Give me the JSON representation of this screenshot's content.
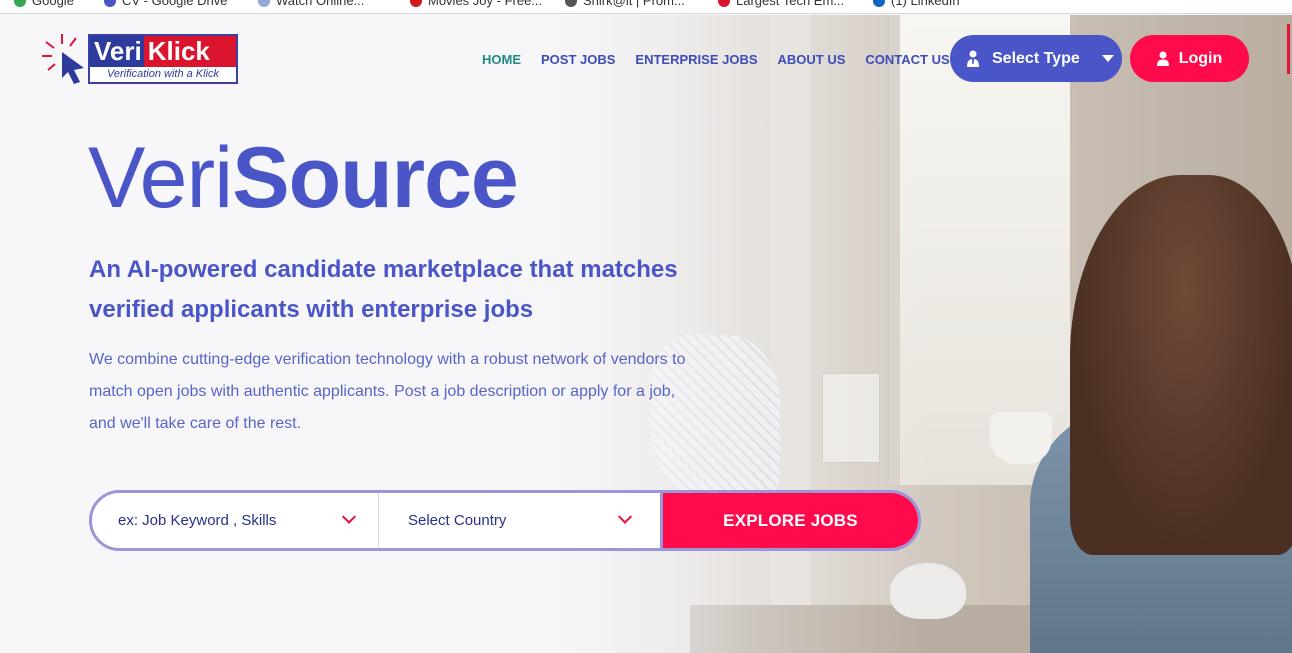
{
  "bookmarks": [
    {
      "label": "Google",
      "color": "#34a853"
    },
    {
      "label": "CV - Google Drive",
      "color": "#4a56c8"
    },
    {
      "label": "Watch Online...",
      "color": "#8fa8d6"
    },
    {
      "label": "Movies Joy - Free...",
      "color": "#d11c1c"
    },
    {
      "label": "Shirk@it | Prom...",
      "color": "#555555"
    },
    {
      "label": "Largest Tech Em...",
      "color": "#d9142c"
    },
    {
      "label": "(1) LinkedIn",
      "color": "#0a66c2"
    }
  ],
  "logo": {
    "word1": "Veri",
    "word2": "Klick",
    "tagline": "Verification with a Klick"
  },
  "nav": {
    "home": "HOME",
    "post_jobs": "POST JOBS",
    "enterprise_jobs": "ENTERPRISE JOBS",
    "about_us": "ABOUT US",
    "contact_us": "CONTACT US"
  },
  "select_type": {
    "label": "Select Type"
  },
  "login": {
    "label": "Login"
  },
  "hero": {
    "title_thin": "Veri",
    "title_bold": "Source",
    "subtitle": "An AI-powered candidate marketplace that matches verified applicants with enterprise jobs",
    "description": "We combine cutting-edge verification technology with a robust network of vendors to match open jobs with authentic applicants. Post a job description or apply for a job, and we'll take care of the rest."
  },
  "search": {
    "keyword_placeholder": "ex: Job Keyword , Skills",
    "country_placeholder": "Select Country",
    "explore_label": "EXPLORE JOBS"
  },
  "colors": {
    "brand_blue": "#4a56c8",
    "brand_red": "#ff0a4b",
    "active_nav": "#1e8a83"
  }
}
